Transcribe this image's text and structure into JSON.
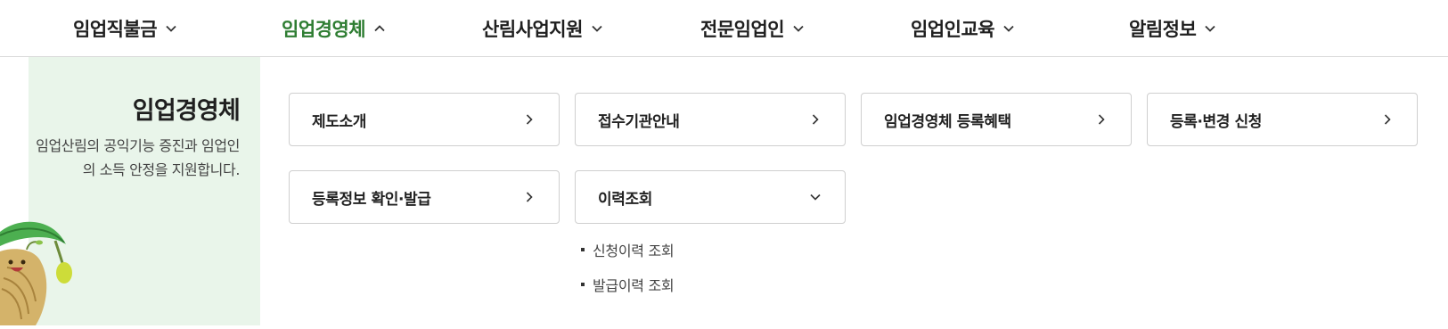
{
  "topnav": {
    "items": [
      {
        "label": "임업직불금",
        "state": "collapsed"
      },
      {
        "label": "임업경영체",
        "state": "expanded"
      },
      {
        "label": "산림사업지원",
        "state": "collapsed"
      },
      {
        "label": "전문임업인",
        "state": "collapsed"
      },
      {
        "label": "임업인교육",
        "state": "collapsed"
      },
      {
        "label": "알림정보",
        "state": "collapsed"
      }
    ],
    "active_color": "#2e7d32"
  },
  "intro": {
    "title": "임업경영체",
    "description": "임업산림의 공익기능 증진과 임업인의 소득 안정을 지원합니다.",
    "background_color": "#e9f5ea"
  },
  "menu": {
    "cards": [
      {
        "label": "제도소개",
        "icon": "chevron-right-icon"
      },
      {
        "label": "접수기관안내",
        "icon": "chevron-right-icon"
      },
      {
        "label": "임업경영체 등록혜택",
        "icon": "chevron-right-icon"
      },
      {
        "label": "등록·변경 신청",
        "icon": "chevron-right-icon"
      },
      {
        "label": "등록정보 확인·발급",
        "icon": "chevron-right-icon"
      },
      {
        "label": "이력조회",
        "icon": "chevron-down-icon"
      }
    ],
    "submenu": {
      "items": [
        {
          "label": "신청이력 조회"
        },
        {
          "label": "발급이력 조회"
        }
      ]
    }
  }
}
